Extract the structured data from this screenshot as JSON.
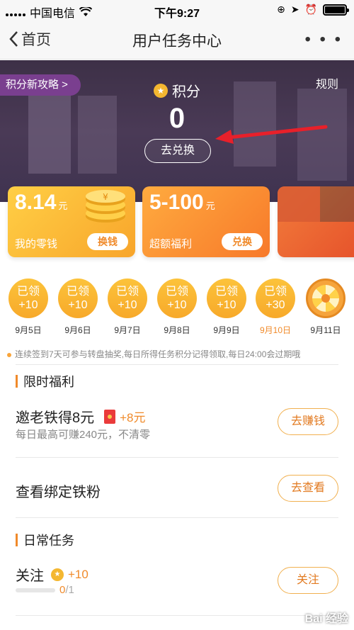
{
  "status_bar": {
    "carrier": "中国电信",
    "time": "下午9:27"
  },
  "nav": {
    "back_label": "首页",
    "title": "用户任务中心",
    "more_label": "• • •"
  },
  "banner": {
    "strategy_label": "积分新攻略 >",
    "rules_label": "规则",
    "points_label": "积分",
    "points_value": "0",
    "redeem_label": "去兑换"
  },
  "cards": [
    {
      "amount": "8.14",
      "unit": "元",
      "label": "我的零钱",
      "button": "换钱"
    },
    {
      "amount": "5-100",
      "unit": "元",
      "label": "超额福利",
      "button": "兑换"
    }
  ],
  "checkin": {
    "days": [
      {
        "status": "已领",
        "points": "+10",
        "date": "9月5日"
      },
      {
        "status": "已领",
        "points": "+10",
        "date": "9月6日"
      },
      {
        "status": "已领",
        "points": "+10",
        "date": "9月7日"
      },
      {
        "status": "已领",
        "points": "+10",
        "date": "9月8日"
      },
      {
        "status": "已领",
        "points": "+10",
        "date": "9月9日"
      },
      {
        "status": "已领",
        "points": "+30",
        "date": "9月10日"
      }
    ],
    "wheel_date": "9月11日",
    "notice": "连续签到7天可参与转盘抽奖,每日所得任务积分记得领取,每日24:00会过期哦"
  },
  "limited": {
    "heading": "限时福利",
    "tasks": [
      {
        "title": "邀老铁得8元",
        "reward": "+8元",
        "subtitle": "每日最高可赚240元，不清零",
        "button": "去赚钱"
      },
      {
        "title": "查看绑定铁粉",
        "button": "去查看"
      }
    ]
  },
  "daily": {
    "heading": "日常任务",
    "tasks": [
      {
        "title": "关注",
        "reward": "+10",
        "progress_done": "0",
        "progress_total": "/1",
        "progress_fraction": 0,
        "button": "关注"
      }
    ]
  },
  "watermark": "Bai 经验",
  "colors": {
    "accent": "#f08a2a",
    "banner_bg": "#3d3047",
    "coin": "#f4b730"
  }
}
